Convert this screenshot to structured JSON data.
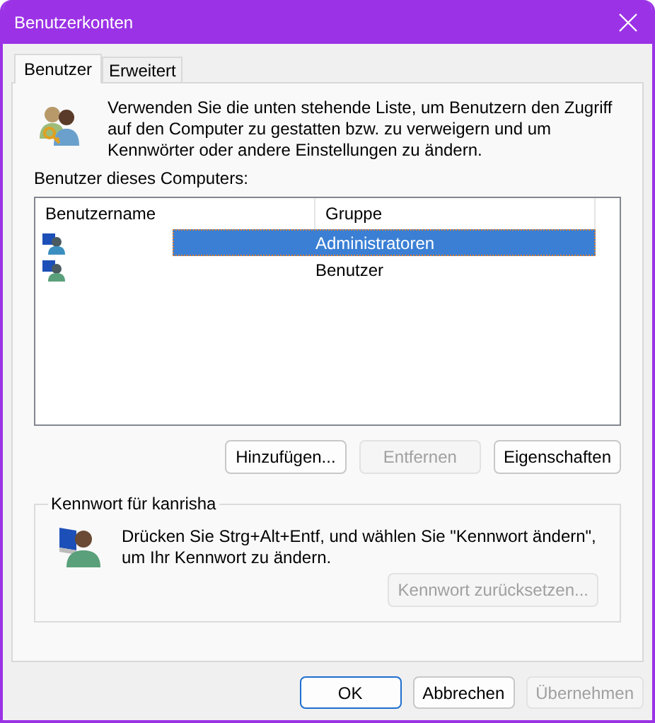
{
  "window": {
    "title": "Benutzerkonten"
  },
  "tabs": [
    {
      "label": "Benutzer",
      "selected": true
    },
    {
      "label": "Erweitert",
      "selected": false
    }
  ],
  "intro": "Verwenden Sie die unten stehende Liste, um Benutzern den Zugriff auf den Computer zu gestatten bzw. zu verweigern und um Kennwörter oder andere Einstellungen zu ändern.",
  "users_label": "Benutzer dieses Computers:",
  "table": {
    "columns": [
      "Benutzername",
      "Gruppe"
    ],
    "rows": [
      {
        "group": "Administratoren",
        "selected": true
      },
      {
        "group": "Benutzer",
        "selected": false
      }
    ]
  },
  "user_buttons": [
    {
      "label": "Hinzufügen...",
      "disabled": false
    },
    {
      "label": "Entfernen",
      "disabled": true
    },
    {
      "label": "Eigenschaften",
      "disabled": false
    }
  ],
  "password_group": {
    "title": "Kennwort für kanrisha",
    "text": "Drücken Sie Strg+Alt+Entf, und wählen Sie \"Kennwort ändern\", um Ihr Kennwort zu ändern.",
    "button": {
      "label": "Kennwort zurücksetzen...",
      "disabled": true
    }
  },
  "dialog_buttons": [
    {
      "label": "OK",
      "disabled": false,
      "default": true
    },
    {
      "label": "Abbrechen",
      "disabled": false,
      "default": false
    },
    {
      "label": "Übernehmen",
      "disabled": true,
      "default": false
    }
  ]
}
